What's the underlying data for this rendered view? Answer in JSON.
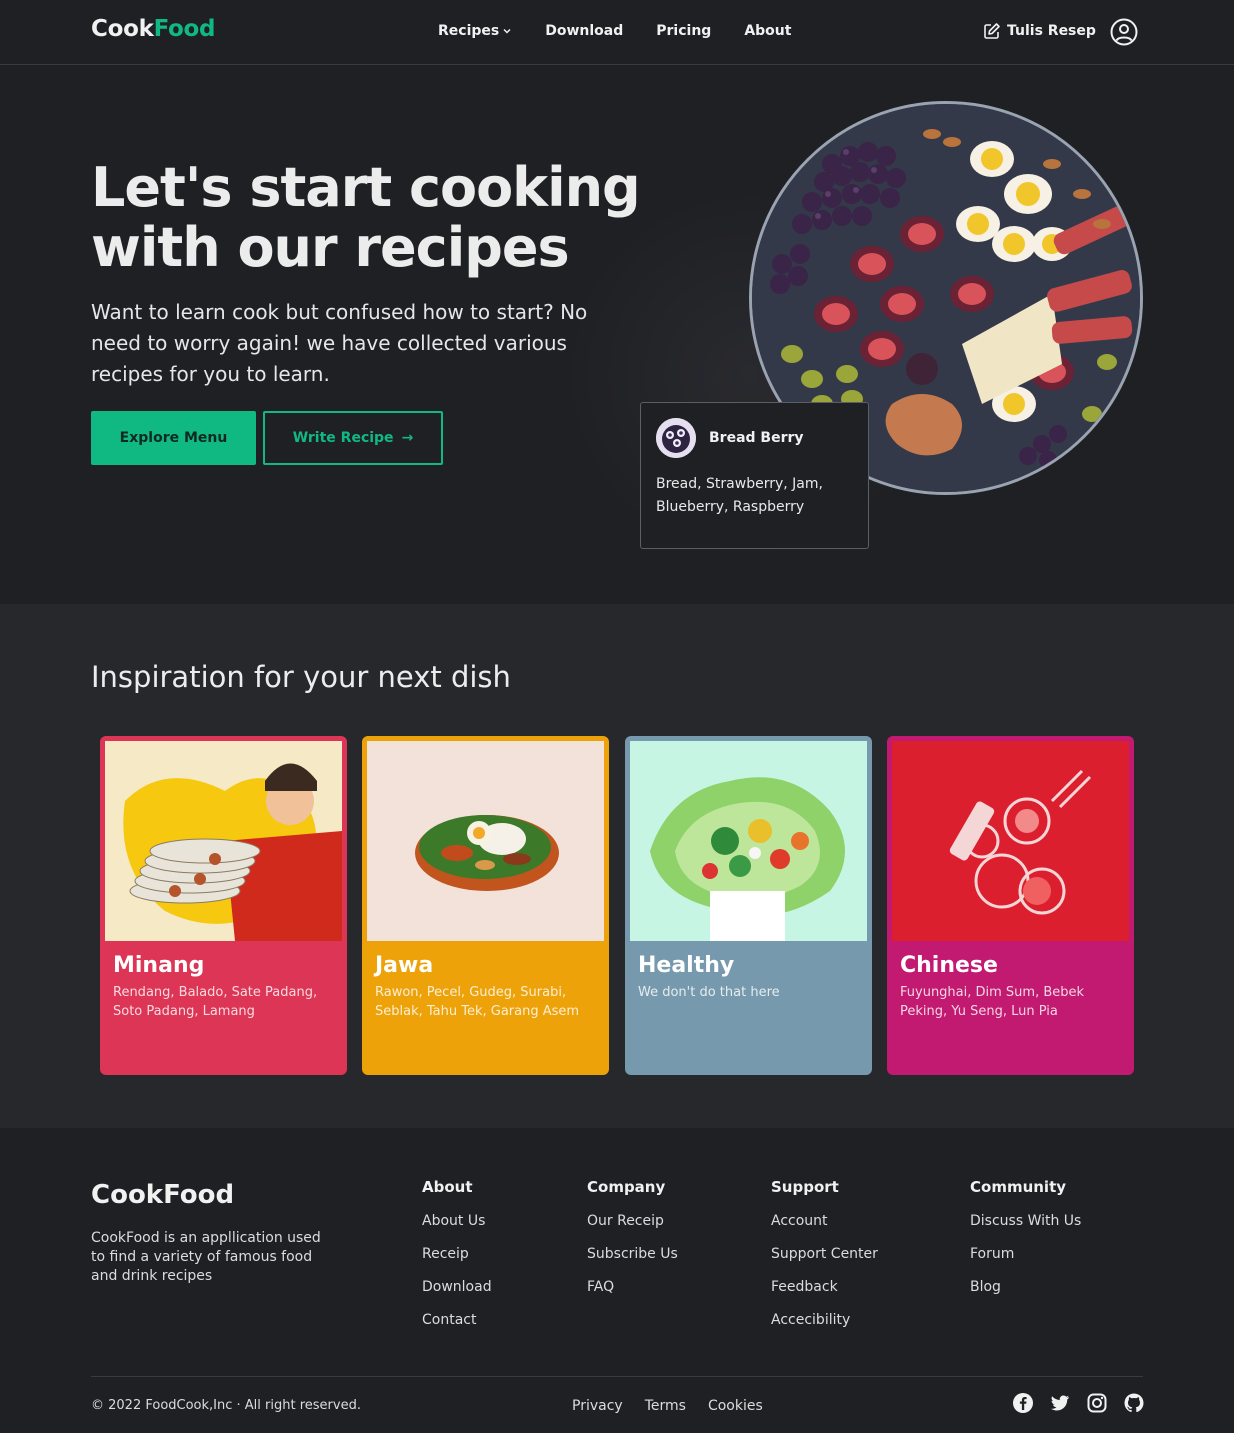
{
  "nav": {
    "logo_cook": "Cook",
    "logo_food": "Food",
    "links": [
      "Recipes",
      "Download",
      "Pricing",
      "About"
    ],
    "write_label": "Tulis Resep"
  },
  "hero": {
    "title": "Let's start cooking with our recipes",
    "subtitle": "Want to learn cook but confused how to start? No need to worry again! we have collected various recipes for you to learn.",
    "explore_label": "Explore Menu",
    "write_label": "Write Recipe",
    "write_arrow": "→",
    "card": {
      "title": "Bread Berry",
      "ingredients": "Bread, Strawberry, Jam, Blueberry, Raspberry"
    }
  },
  "inspiration": {
    "heading": "Inspiration for your next dish",
    "cards": [
      {
        "title": "Minang",
        "desc": "Rendang, Balado, Sate Padang, Soto Padang, Lamang",
        "color": "#dc3555",
        "img_bg": "#f5e7c7"
      },
      {
        "title": "Jawa",
        "desc": "Rawon, Pecel, Gudeg, Surabi, Seblak, Tahu Tek, Garang Asem",
        "color": "#eda20a",
        "img_bg": "#f2e2da"
      },
      {
        "title": "Healthy",
        "desc": "We don't do that here",
        "color": "#7699ad",
        "img_bg": "#c6f5e4"
      },
      {
        "title": "Chinese",
        "desc": "Fuyunghai, Dim Sum, Bebek Peking, Yu Seng, Lun Pia",
        "color": "#c21a70",
        "img_bg": "#dc1f2e"
      }
    ]
  },
  "footer": {
    "logo": "CookFood",
    "desc": "CookFood is an appllication used to find a variety of famous food and drink recipes",
    "columns": [
      {
        "title": "About",
        "links": [
          "About Us",
          "Receip",
          "Download",
          "Contact"
        ]
      },
      {
        "title": "Company",
        "links": [
          "Our Receip",
          "Subscribe Us",
          "FAQ"
        ]
      },
      {
        "title": "Support",
        "links": [
          "Account",
          "Support Center",
          "Feedback",
          "Accecibility"
        ]
      },
      {
        "title": "Community",
        "links": [
          "Discuss With Us",
          "Forum",
          "Blog"
        ]
      }
    ],
    "copyright": "© 2022 FoodCook,Inc · All right reserved.",
    "legal": [
      "Privacy",
      "Terms",
      "Cookies"
    ],
    "socials": [
      "facebook-icon",
      "twitter-icon",
      "instagram-icon",
      "github-icon"
    ]
  },
  "colors": {
    "accent": "#10b981",
    "background": "#1f2024",
    "section_background": "#27282c"
  }
}
